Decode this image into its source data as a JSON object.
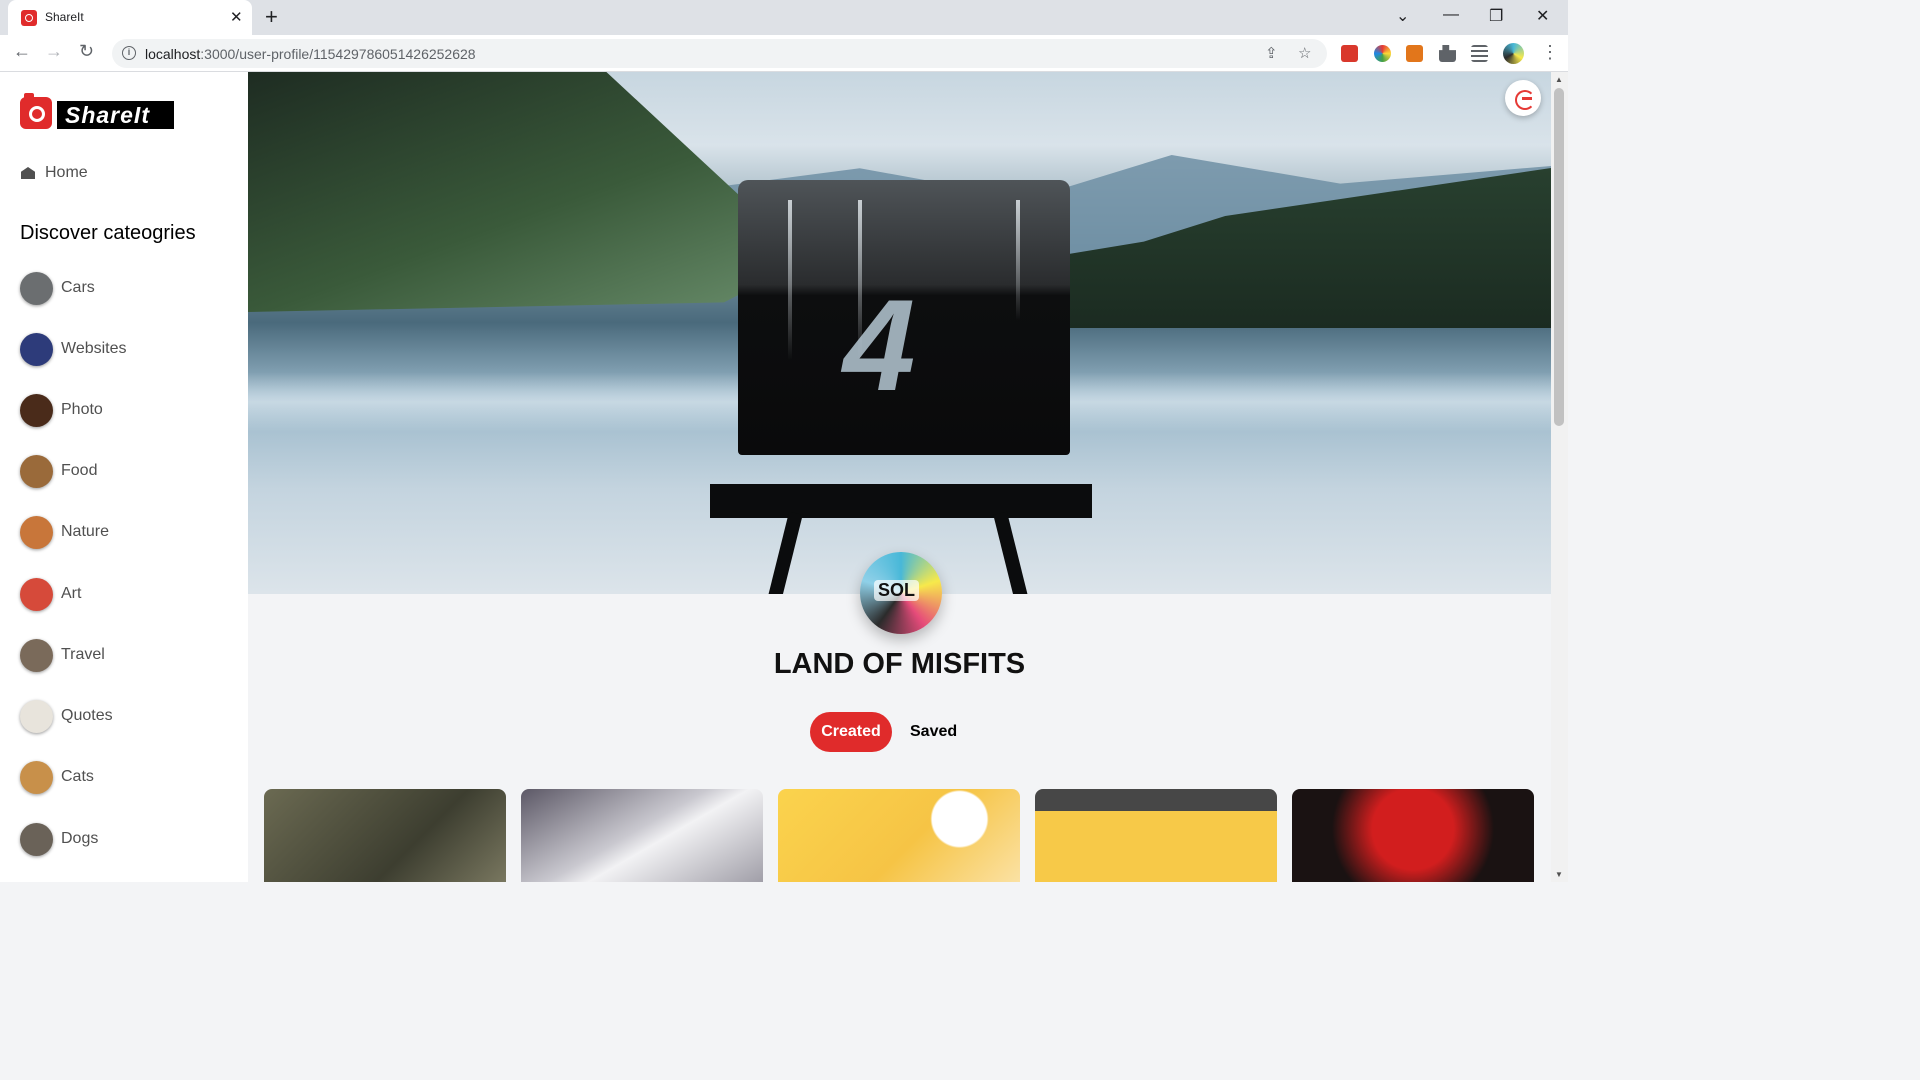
{
  "browser": {
    "tab_title": "ShareIt",
    "tab_close": "✕",
    "new_tab": "+",
    "url_host": "localhost",
    "url_rest": ":3000/user-profile/115429786051426252628",
    "back": "←",
    "forward": "→",
    "reload": "↻",
    "share": "⇪",
    "star": "☆",
    "menu": "⋮",
    "minimize": "—",
    "maximize": "❐",
    "close": "✕",
    "tab_list": "⌄"
  },
  "sidebar": {
    "logo_text": "ShareIt",
    "home_label": "Home",
    "discover_title": "Discover cateogries",
    "categories": [
      {
        "label": "Cars",
        "color": "#6b6e70"
      },
      {
        "label": "Websites",
        "color": "#2d3b7a"
      },
      {
        "label": "Photo",
        "color": "#4a2b1a"
      },
      {
        "label": "Food",
        "color": "#9a6a3a"
      },
      {
        "label": "Nature",
        "color": "#c8763a"
      },
      {
        "label": "Art",
        "color": "#d64a3a"
      },
      {
        "label": "Travel",
        "color": "#7a6a5a"
      },
      {
        "label": "Quotes",
        "color": "#e8e4dc"
      },
      {
        "label": "Cats",
        "color": "#c8904a"
      },
      {
        "label": "Dogs",
        "color": "#6a6258"
      }
    ]
  },
  "profile": {
    "username": "LAND OF MISFITS",
    "tabs": {
      "created": "Created",
      "saved": "Saved"
    },
    "accent_color": "#e02b2b",
    "banner_number": "4"
  },
  "pins": [
    {
      "name": "pin-soldiers-image",
      "color": "#5a5a48"
    },
    {
      "name": "pin-laptop-image",
      "color": "#8c8894"
    },
    {
      "name": "pin-juice-image",
      "color": "#f6c445"
    },
    {
      "name": "pin-landing-page-image",
      "color": "#3a3a3a"
    },
    {
      "name": "pin-sol-logo-image",
      "color": "#1a1212"
    }
  ]
}
